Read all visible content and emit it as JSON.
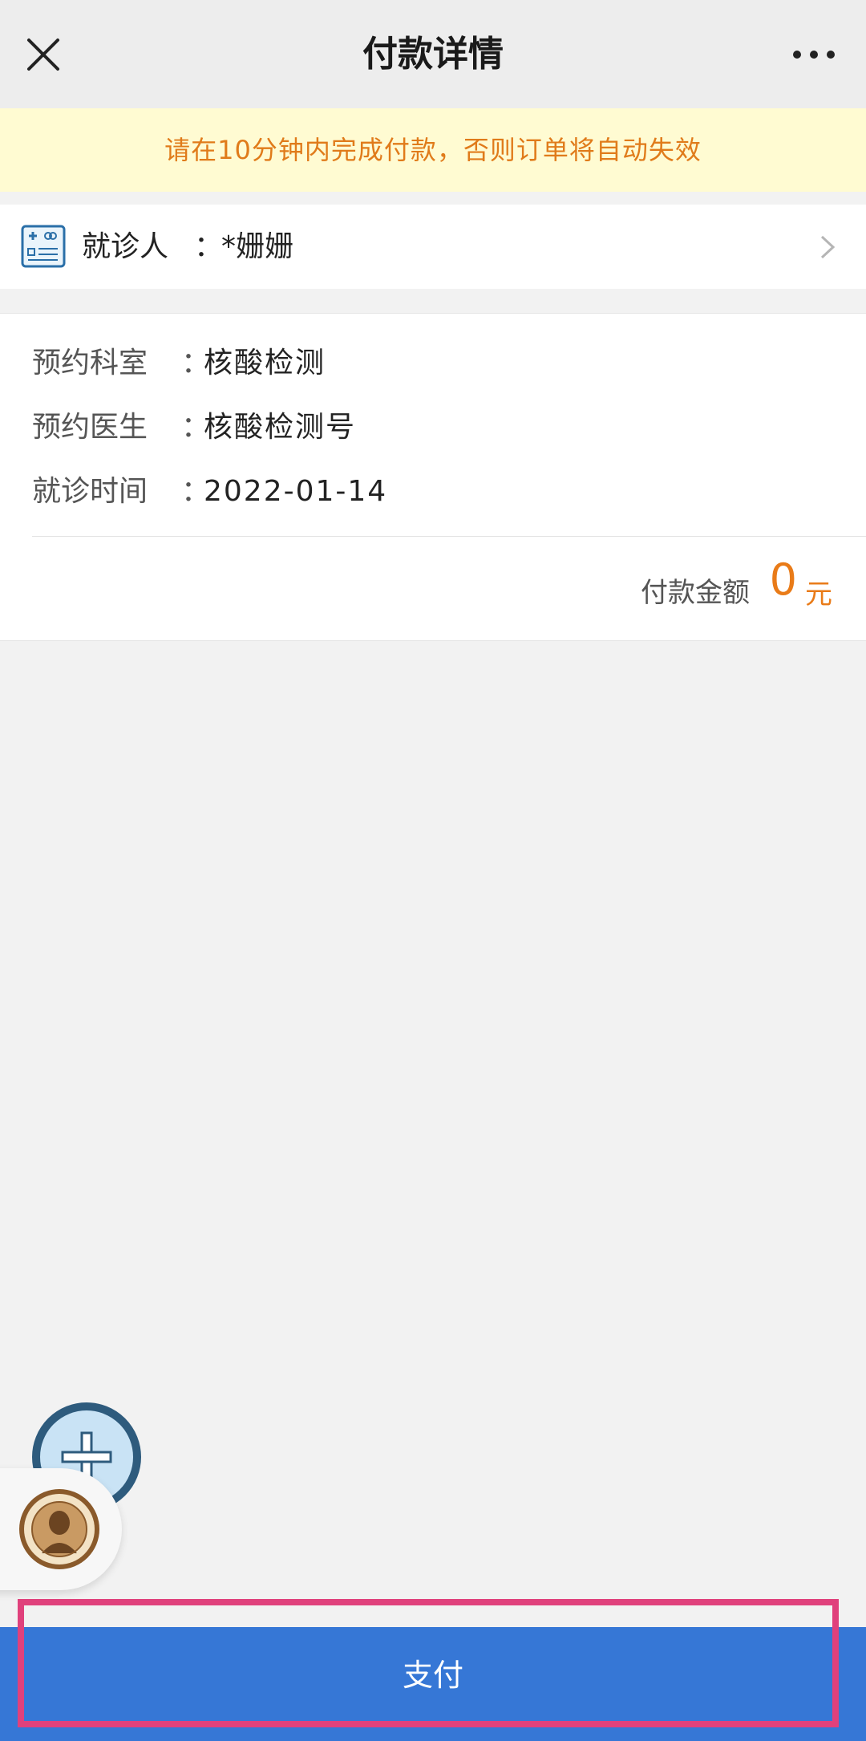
{
  "navbar": {
    "title": "付款详情",
    "close_icon": "close-icon",
    "more_icon": "more-icon"
  },
  "notice": {
    "text": "请在10分钟内完成付款，否则订单将自动失效",
    "color": "#e07b1a",
    "background": "#fffbd2"
  },
  "patient": {
    "icon": "medical-card-icon",
    "label": "就诊人",
    "colon": "：",
    "name": "*姗姗",
    "chevron_icon": "chevron-right-icon"
  },
  "details": [
    {
      "label": "预约科室",
      "colon": "：",
      "value": "核酸检测"
    },
    {
      "label": "预约医生",
      "colon": "：",
      "value": "核酸检测号"
    },
    {
      "label": "就诊时间",
      "colon": "：",
      "value": "2022-01-14"
    }
  ],
  "payment": {
    "amount_label": "付款金额",
    "amount": "0",
    "unit": "元",
    "accent_color": "#e97b18"
  },
  "floating": {
    "add_icon": "plus-icon",
    "logo_icon": "hospital-seal-icon"
  },
  "pay": {
    "label": "支付",
    "color": "#3677d6",
    "highlight_color": "#e0417c"
  }
}
